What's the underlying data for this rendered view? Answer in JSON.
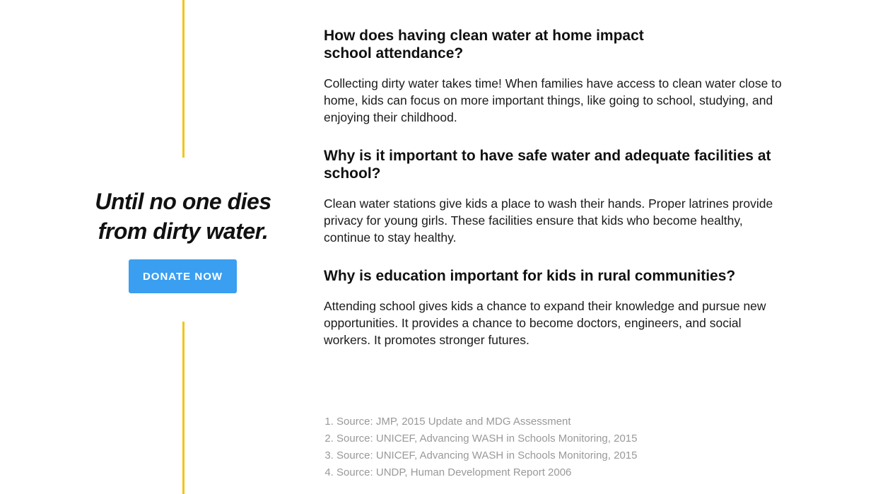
{
  "tagline": {
    "pre": "Until",
    "highlight": "no one",
    "post": "dies",
    "line2": "from dirty water."
  },
  "donate": {
    "label": "DONATE NOW"
  },
  "faq": [
    {
      "question": "How does having clean water at home impact school attendance?",
      "answer": "Collecting dirty water takes time! When families have access to clean water close to home, kids can focus on more important things, like going to school, studying, and enjoying their childhood."
    },
    {
      "question": "Why is it important to have safe water and adequate facilities at school?",
      "answer": "Clean water stations give kids a place to wash their hands. Proper latrines provide privacy for young girls. These facilities ensure that kids who become healthy, continue to stay healthy."
    },
    {
      "question": "Why is education important for kids in rural communities?",
      "answer": "Attending school gives kids a chance to expand their knowledge and pursue new opportunities. It provides a chance to become doctors, engineers, and social workers. It promotes stronger futures."
    }
  ],
  "sources": [
    "Source: JMP, 2015 Update and MDG Assessment",
    "Source: UNICEF, Advancing WASH in Schools Monitoring, 2015",
    "Source: UNICEF, Advancing WASH in Schools Monitoring, 2015",
    "Source: UNDP, Human Development Report 2006"
  ],
  "colors": {
    "accent_yellow": "#f5c518",
    "button_blue": "#3a9ff0",
    "source_gray": "#999999"
  }
}
